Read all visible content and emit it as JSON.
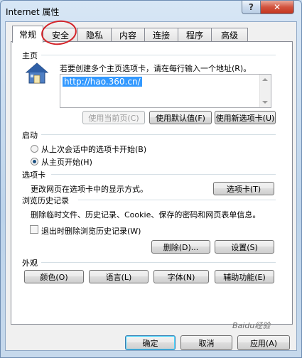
{
  "window": {
    "title": "Internet 属性",
    "help": "?",
    "close": "✕"
  },
  "tabs": [
    "常规",
    "安全",
    "隐私",
    "内容",
    "连接",
    "程序",
    "高级"
  ],
  "home": {
    "heading": "主页",
    "description": "若要创建多个主页选项卡，请在每行输入一个地址(R)。",
    "url": "http://hao.360.cn/",
    "use_current": "使用当前页(C)",
    "use_default": "使用默认值(F)",
    "use_new_tab": "使用新选项卡(U)"
  },
  "startup": {
    "heading": "启动",
    "option_last_session": "从上次会话中的选项卡开始(B)",
    "option_home_page": "从主页开始(H)",
    "selected": "option_home_page"
  },
  "tabs_section": {
    "heading": "选项卡",
    "description": "更改网页在选项卡中的显示方式。",
    "button": "选项卡(T)"
  },
  "history": {
    "heading": "浏览历史记录",
    "description": "删除临时文件、历史记录、Cookie、保存的密码和网页表单信息。",
    "checkbox": "退出时删除浏览历史记录(W)",
    "delete": "删除(D)...",
    "settings": "设置(S)"
  },
  "appearance": {
    "heading": "外观",
    "colors": "颜色(O)",
    "languages": "语言(L)",
    "fonts": "字体(N)",
    "accessibility": "辅助功能(E)"
  },
  "footer": {
    "ok": "确定",
    "cancel": "取消",
    "apply": "应用(A)"
  },
  "watermark": "Baidu经验"
}
